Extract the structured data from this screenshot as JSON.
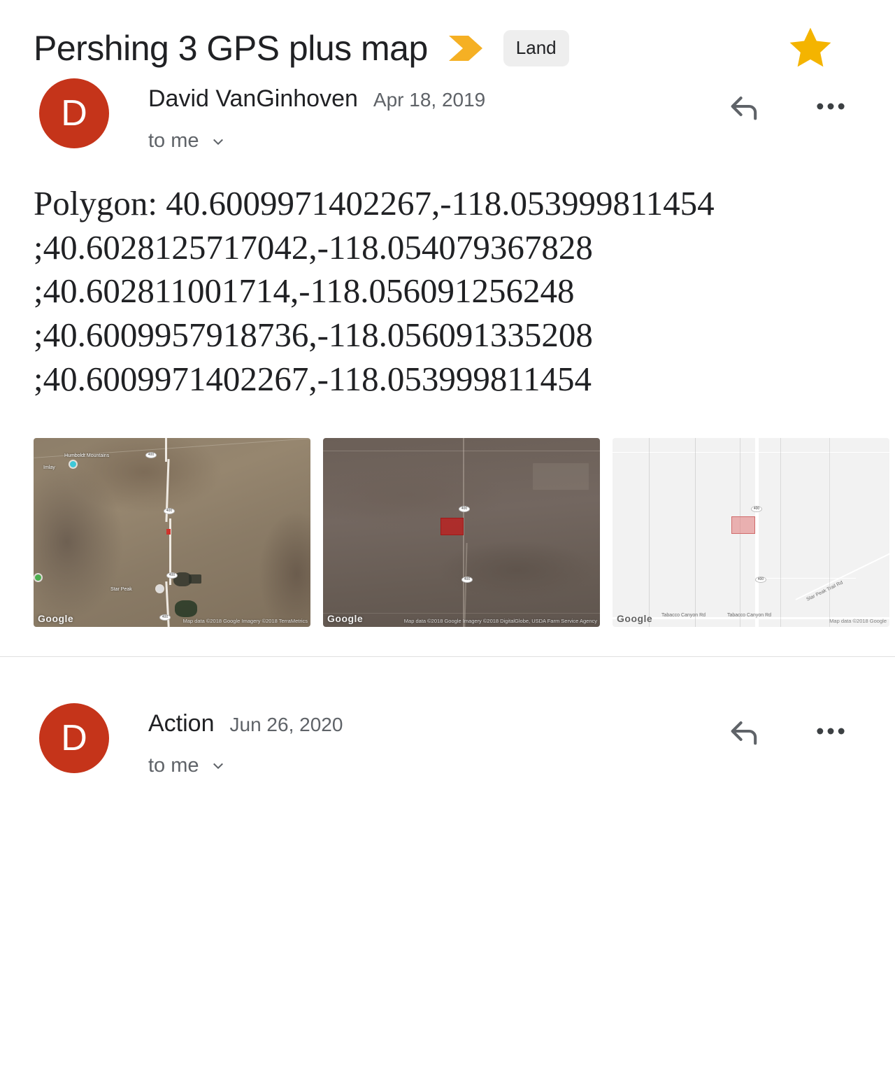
{
  "header": {
    "subject": "Pershing 3 GPS plus map",
    "important_marker_icon": "important-chevron-icon",
    "label_chip": "Land",
    "star_icon": "star-filled-icon",
    "star_color": "#F4B400",
    "important_marker_color": "#F5B024",
    "chip_bg_color": "#EEEEEE"
  },
  "messages": [
    {
      "avatar_initial": "D",
      "avatar_color": "#C5341A",
      "sender": "David VanGinhoven",
      "date": "Apr 18, 2019",
      "recipient": "to me",
      "recipient_caret_icon": "chevron-down-icon",
      "reply_icon": "reply-arrow-icon",
      "more_icon": "more-options-icon",
      "body": "Polygon: 40.6009971402267,-118.053999811454 ;40.6028125717042,-118.054079367828 ;40.602811001714,-118.056091256248 ;40.6009957918736,-118.056091335208 ;40.6009971402267,-118.053999811454",
      "attachments": [
        {
          "name": "satellite-overview-map",
          "style": "satellite-wide",
          "watermark": "Google",
          "attribution": "Map data ©2018 Google  Imagery ©2018 TerraMetrics",
          "labels": [
            "Humboldt Mountains",
            "Imlay"
          ],
          "road_shields": [
            "400",
            "400",
            "400",
            "400"
          ]
        },
        {
          "name": "satellite-parcel-map",
          "style": "satellite-close",
          "watermark": "Google",
          "attribution": "Map data ©2018 Google  Imagery ©2018  DigitalGlobe, USDA Farm Service Agency",
          "labels": [],
          "road_shields": [
            "400",
            "400"
          ],
          "parcel_color": "#BE1E1E"
        },
        {
          "name": "roadmap-parcel-map",
          "style": "roadmap",
          "watermark": "Google",
          "attribution": "Map data ©2018 Google",
          "labels": [
            "Tabacco Canyon Rd",
            "Tabacco Canyon Rd",
            "Star Peak Trail Rd"
          ],
          "road_shields": [
            "400",
            "400"
          ],
          "parcel_color": "#E27A7A"
        }
      ]
    },
    {
      "avatar_initial": "D",
      "avatar_color": "#C5341A",
      "sender": "Action",
      "date": "Jun 26, 2020",
      "recipient": "to me",
      "recipient_caret_icon": "chevron-down-icon",
      "reply_icon": "reply-arrow-icon",
      "more_icon": "more-options-icon"
    }
  ]
}
